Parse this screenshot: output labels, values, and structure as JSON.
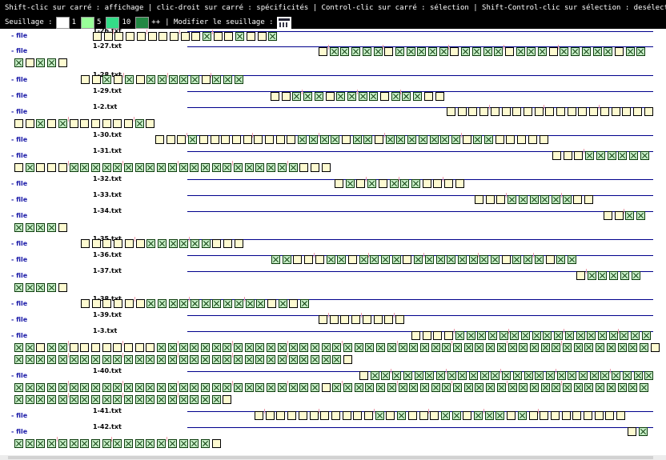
{
  "header": {
    "instructions": "Shift-clic sur carré : affichage | clic-droit sur carré : spécificités | Control-clic sur carré : sélection | Shift-Control-clic sur sélection : desélection",
    "threshold_label": "Seuillage :",
    "thresholds": [
      {
        "label": "1",
        "color": "#ffffff"
      },
      {
        "label": "5",
        "color": "#99ff99"
      },
      {
        "label": "10",
        "color": "#33dd88"
      },
      {
        "label": "++",
        "color": "#228844"
      }
    ],
    "modify_label": "| Modifier le seuillage :",
    "calc_icon": "calculator-icon"
  },
  "rows": [
    {
      "id": "- file",
      "name": "1-26.txt"
    },
    {
      "id": "- file",
      "name": "1-27.txt"
    },
    {
      "id": "- file",
      "name": "1-28.txt"
    },
    {
      "id": "- file",
      "name": "1-29.txt"
    },
    {
      "id": "- file",
      "name": "1-2.txt"
    },
    {
      "id": "- file",
      "name": "1-30.txt"
    },
    {
      "id": "- file",
      "name": "1-31.txt"
    },
    {
      "id": "- file",
      "name": "1-32.txt"
    },
    {
      "id": "- file",
      "name": "1-33.txt"
    },
    {
      "id": "- file",
      "name": "1-34.txt"
    },
    {
      "id": "- file",
      "name": "1-35.txt"
    },
    {
      "id": "- file",
      "name": "1-36.txt"
    },
    {
      "id": "- file",
      "name": "1-37.txt"
    },
    {
      "id": "- file",
      "name": "1-38.txt"
    },
    {
      "id": "- file",
      "name": "1-39.txt"
    },
    {
      "id": "- file",
      "name": "1-3.txt"
    },
    {
      "id": "- file",
      "name": "1-40.txt"
    },
    {
      "id": "- file",
      "name": "1-41.txt"
    },
    {
      "id": "- file",
      "name": "1-42.txt"
    }
  ]
}
